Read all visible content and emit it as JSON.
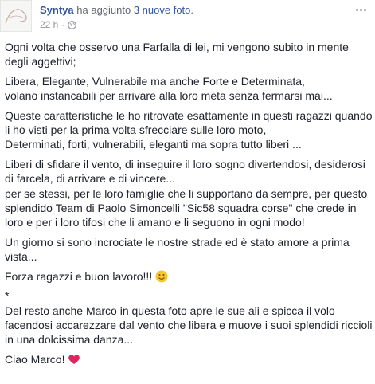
{
  "post": {
    "author": "Syntya",
    "action": "ha aggiunto",
    "photos_link": "3 nuove foto",
    "punct": ".",
    "time": "22 h",
    "dot": "·",
    "privacy_icon": "globe-icon",
    "options_icon": "more-horizontal-icon"
  },
  "body": {
    "p1": "Ogni volta che osservo una Farfalla di lei, mi vengono subito in mente degli aggettivi;",
    "p2": "Libera, Elegante, Vulnerabile ma anche Forte e Determinata,\nvolano instancabili per arrivare alla loro meta senza fermarsi mai...",
    "p3": "Queste caratteristiche le ho ritrovate esattamente in questi ragazzi quando li ho visti per la prima volta sfrecciare sulle loro moto,\nDeterminati, forti, vulnerabili, eleganti ma sopra tutto liberi ...",
    "p4": "Liberi di sfidare il vento, di inseguire il loro sogno divertendosi, desiderosi di farcela, di arrivare e di vincere...\nper se stessi, per le loro famiglie che li supportano da sempre, per questo splendido Team di Paolo Simoncelli \"Sic58 squadra corse\" che crede in loro e per i loro tifosi che li amano e li seguono in ogni modo!",
    "p5": "Un giorno si sono incrociate le nostre strade ed è stato amore a prima vista...",
    "p6": "Forza ragazzi e buon lavoro!!! ",
    "p6_emoji": "smile-emoji",
    "p7": "*",
    "p8": "Del resto anche Marco in questa foto apre le sue ali e spicca il volo facendosi accarezzare dal vento che libera e muove i suoi splendidi riccioli in una dolcissima danza...",
    "p9": "Ciao Marco! ",
    "p9_emoji": "heart-emoji"
  },
  "colors": {
    "link": "#365899",
    "text": "#1d2129",
    "meta": "#90949c",
    "heart": "#e0245e",
    "emoji_face": "#f7c62f"
  }
}
